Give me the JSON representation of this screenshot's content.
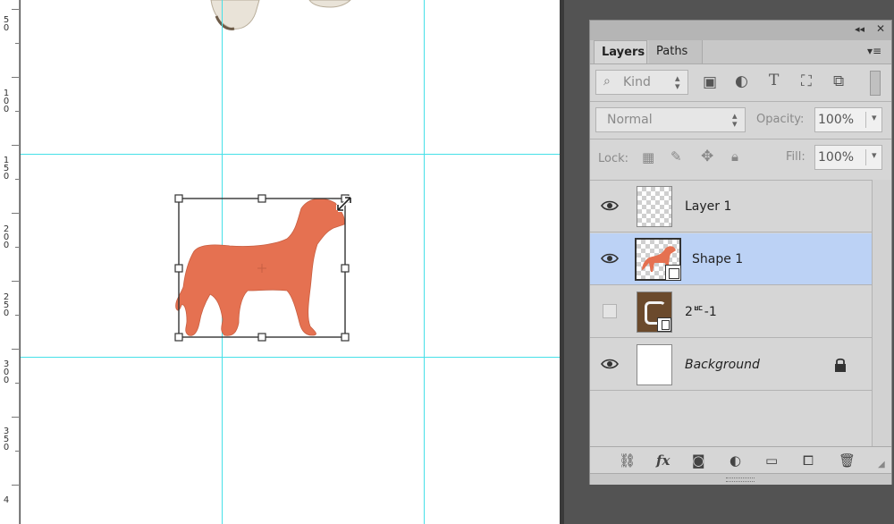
{
  "ruler": {
    "labels": [
      "5\n0",
      "1\n0\n0",
      "1\n5\n0",
      "2\n0\n0",
      "2\n5\n0",
      "3\n0\n0",
      "3\n5\n0",
      "4"
    ]
  },
  "panel": {
    "collapse_label": "◂◂",
    "close_label": "✕",
    "tabs": {
      "layers": "Layers",
      "paths": "Paths"
    },
    "menu_label": "▾≡",
    "filter": {
      "icon": "search-icon",
      "label": "Kind"
    },
    "blend_mode": "Normal",
    "opacity_label": "Opacity:",
    "opacity_value": "100%",
    "lock_label": "Lock:",
    "fill_label": "Fill:",
    "fill_value": "100%",
    "layers": [
      {
        "name": "Layer 1",
        "visible": true,
        "selected": false
      },
      {
        "name": "Shape 1",
        "visible": true,
        "selected": true
      },
      {
        "name": "2ᄠ-1",
        "visible": false,
        "selected": false
      },
      {
        "name": "Background",
        "visible": true,
        "selected": false,
        "locked": true
      }
    ],
    "footer_fx_label": "fx"
  },
  "colors": {
    "shape_fill": "#e57151",
    "guide": "#46e0e8",
    "selected_row": "#bcd2f5"
  }
}
